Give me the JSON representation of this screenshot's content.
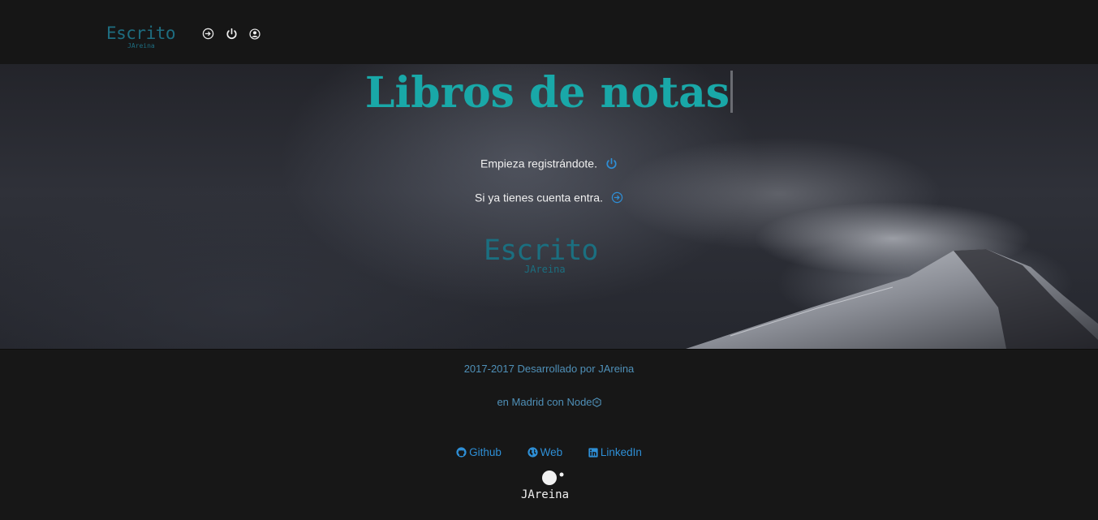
{
  "header": {
    "logo": {
      "title": "Escrito",
      "subtitle": "JAreina"
    },
    "icons": [
      "sign-in-icon",
      "power-icon",
      "user-icon"
    ]
  },
  "hero": {
    "title": "Libros de notas",
    "register_text": "Empieza registrándote.",
    "login_text": "Si ya tienes cuenta entra.",
    "logo": {
      "title": "Escrito",
      "subtitle": "JAreina"
    }
  },
  "footer": {
    "credit": "2017-2017 Desarrollado por JAreina",
    "location": "en Madrid con Node",
    "links": [
      {
        "label": "Github",
        "icon": "github-icon"
      },
      {
        "label": "Web",
        "icon": "globe-icon"
      },
      {
        "label": "LinkedIn",
        "icon": "linkedin-icon"
      }
    ],
    "brand": "JAreina"
  },
  "colors": {
    "accent": "#19a8a8",
    "logo": "#1e6d80",
    "link": "#2e8fd6",
    "footer_text": "#4f90b8",
    "background": "#171717"
  }
}
